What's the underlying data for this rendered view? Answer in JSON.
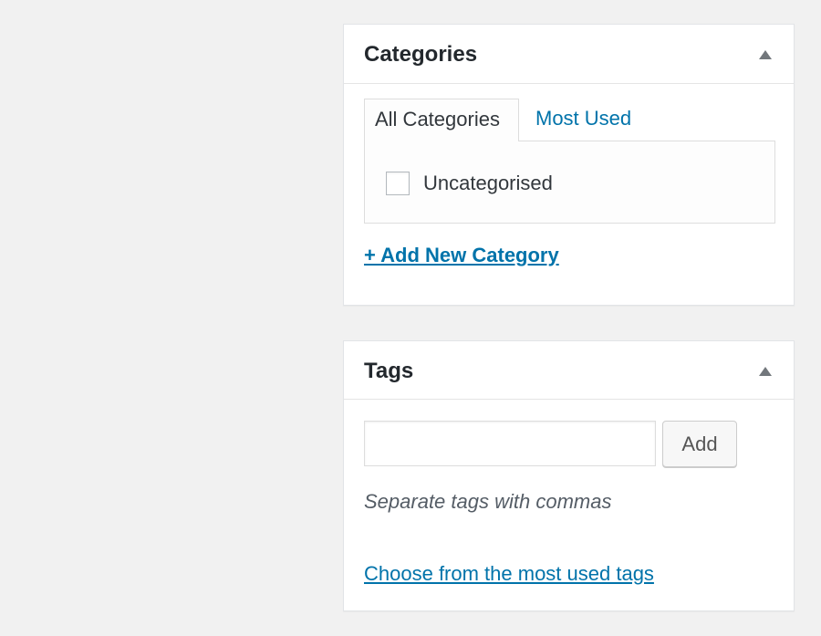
{
  "categories_box": {
    "title": "Categories",
    "toggle_icon": "triangle-up-icon",
    "tabs": [
      {
        "label": "All Categories",
        "active": true
      },
      {
        "label": "Most Used",
        "active": false
      }
    ],
    "items": [
      {
        "label": "Uncategorised",
        "checked": false
      }
    ],
    "add_new_label": "+ Add New Category"
  },
  "tags_box": {
    "title": "Tags",
    "toggle_icon": "triangle-up-icon",
    "input_value": "",
    "add_button_label": "Add",
    "hint": "Separate tags with commas",
    "choose_link": "Choose from the most used tags"
  },
  "colors": {
    "page_background": "#f1f1f1",
    "panel_background": "#ffffff",
    "link": "#0073aa",
    "text": "#23282d",
    "arrow": "#72777c"
  }
}
